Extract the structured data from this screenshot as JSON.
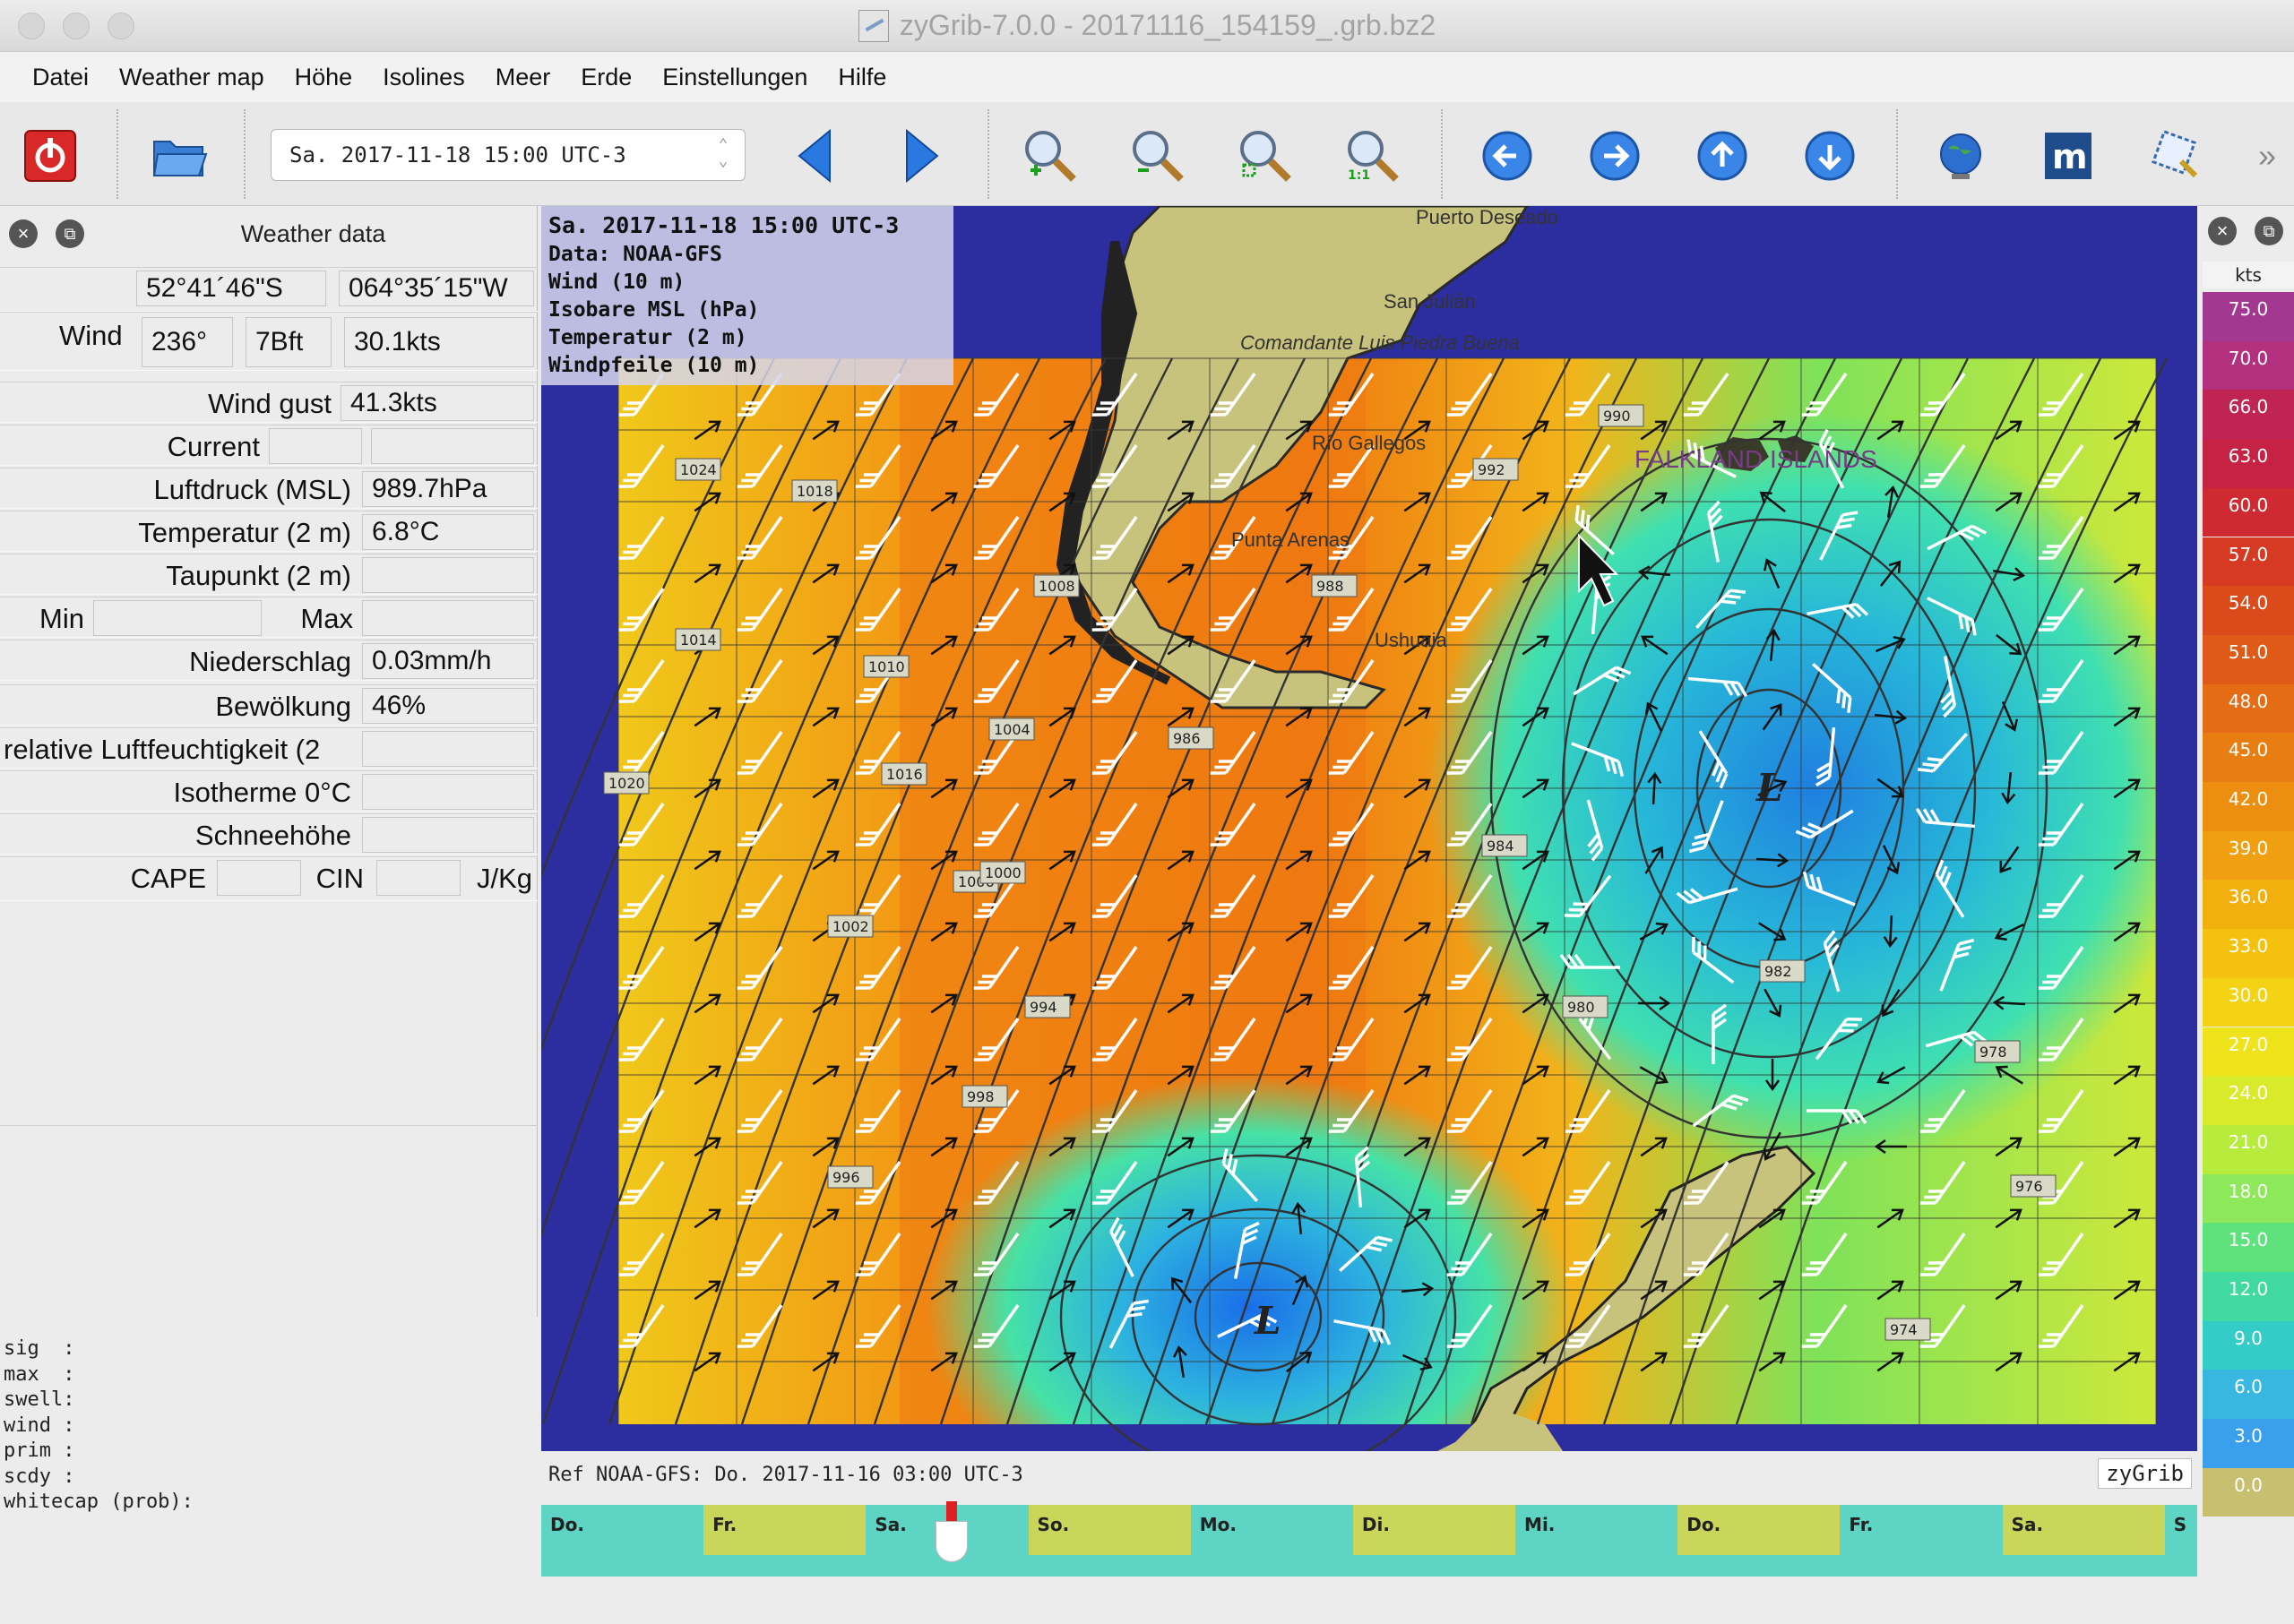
{
  "window": {
    "title": "zyGrib-7.0.0 - 20171116_154159_.grb.bz2"
  },
  "menu": [
    "Datei",
    "Weather map",
    "Höhe",
    "Isolines",
    "Meer",
    "Erde",
    "Einstellungen",
    "Hilfe"
  ],
  "toolbar": {
    "date_value": "Sa. 2017-11-18 15:00 UTC-3",
    "icons": [
      "power-icon",
      "open-folder-icon",
      "prev-forecast-icon",
      "next-forecast-icon",
      "zoom-in-icon",
      "zoom-out-icon",
      "zoom-fit-icon",
      "zoom-1to1-icon",
      "pan-left-icon",
      "pan-right-icon",
      "pan-up-icon",
      "pan-down-icon",
      "globe-icon",
      "meteoblue-icon",
      "select-area-icon",
      "more-icon"
    ],
    "overflow": "»"
  },
  "weather_panel": {
    "title": "Weather data",
    "lat": "52°41´46\"S",
    "lon": "064°35´15\"W",
    "wind_label": "Wind",
    "wind_dir": "236°",
    "wind_bft": "7Bft",
    "wind_speed": "30.1kts",
    "gust_label": "Wind gust",
    "gust_value": "41.3kts",
    "current_label": "Current",
    "pressure_label": "Luftdruck (MSL)",
    "pressure_value": "989.7hPa",
    "temp_label": "Temperatur (2 m)",
    "temp_value": "6.8°C",
    "dew_label": "Taupunkt (2 m)",
    "min_label": "Min",
    "max_label": "Max",
    "precip_label": "Niederschlag",
    "precip_value": "0.03mm/h",
    "cloud_label": "Bewölkung",
    "cloud_value": "46%",
    "humidity_label": "relative Luftfeuchtigkeit (2",
    "iso_label": "Isotherme 0°C",
    "snow_label": "Schneehöhe",
    "cape_label": "CAPE",
    "cin_label": "CIN",
    "jkg_label": "J/Kg",
    "sig_text": "sig  :\nmax  :\nswell:\nwind :\nprim :\nscdy :\nwhitecap (prob):"
  },
  "map": {
    "overlay_lines": [
      "Sa. 2017-11-18 15:00 UTC-3",
      "Data: NOAA-GFS",
      "Wind (10 m)",
      "Isobare MSL (hPa)",
      "Temperatur (2 m)",
      "Windpfeile (10 m)"
    ],
    "places": [
      "Puerto Deseado",
      "San Julián",
      "Comandante Luis Piedra Buena",
      "Río Gallegos",
      "Punta Arenas",
      "Ushuaia",
      "FALKLAND ISLANDS"
    ],
    "pressure_labels": [
      "1024",
      "1018",
      "1014",
      "1020",
      "1016",
      "1010",
      "1008",
      "1004",
      "1006",
      "1002",
      "1000",
      "998",
      "996",
      "994",
      "992",
      "990",
      "988",
      "986",
      "984",
      "982",
      "980",
      "978",
      "976",
      "974"
    ],
    "low_marker": "L",
    "ref_text": "Ref NOAA-GFS: Do. 2017-11-16 03:00 UTC-3",
    "brand": "zyGrib"
  },
  "scale": {
    "unit": "kts",
    "values": [
      "75.0",
      "70.0",
      "66.0",
      "63.0",
      "60.0",
      "57.0",
      "54.0",
      "51.0",
      "48.0",
      "45.0",
      "42.0",
      "39.0",
      "36.0",
      "33.0",
      "30.0",
      "27.0",
      "24.0",
      "21.0",
      "18.0",
      "15.0",
      "12.0",
      "9.0",
      "6.0",
      "3.0",
      "0.0"
    ],
    "colors": [
      "#a2388f",
      "#b2307e",
      "#c02455",
      "#c62244",
      "#cf2a31",
      "#d63a22",
      "#db4a1b",
      "#e05a17",
      "#e46c14",
      "#e87d12",
      "#ec8f10",
      "#ef9f0f",
      "#f2b00e",
      "#f4c10f",
      "#f3d313",
      "#efe31b",
      "#d9ea2a",
      "#b8ec3c",
      "#8ee95a",
      "#5fe27c",
      "#3fd9a1",
      "#34ccc6",
      "#38b7e0",
      "#3a9fec",
      "#c8c070"
    ]
  },
  "timeline": {
    "days": [
      "Do.",
      "Fr.",
      "Sa.",
      "So.",
      "Mo.",
      "Di.",
      "Mi.",
      "Do.",
      "Fr.",
      "Sa.",
      "S"
    ]
  },
  "colors": {
    "map_border": "#2c2ea0",
    "cursor_marker": "#e02020"
  }
}
